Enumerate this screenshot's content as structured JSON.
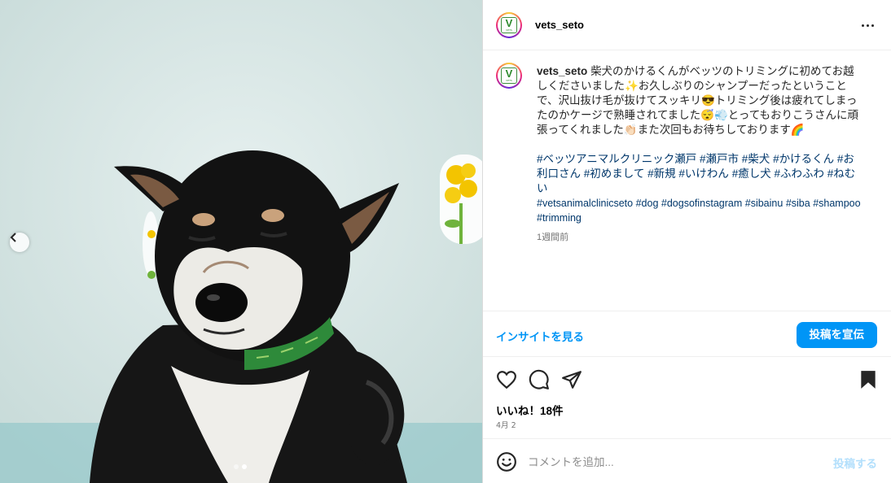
{
  "post": {
    "username": "vets_seto",
    "caption_text": "柴犬のかけるくんがベッツのトリミングに初めてお越しくださいました✨お久しぶりのシャンプーだったということで、沢山抜け毛が抜けてスッキリ😎トリミング後は疲れてしまったのかケージで熟睡されてました😴💨とってもおりこうさんに頑張ってくれました👏🏻また次回もお待ちしております🌈",
    "hashtags_ja": [
      "#ベッツアニマルクリニック瀬戸",
      "#瀬戸市",
      "#柴犬",
      "#かけるくん",
      "#お利口さん",
      "#初めまして",
      "#新規",
      "#いけわん",
      "#癒し犬",
      "#ふわふわ",
      "#ねむい"
    ],
    "hashtags_en": [
      "#vetsanimalclinicseto",
      "#dog",
      "#dogsofinstagram",
      "#sibainu",
      "#siba",
      "#shampoo",
      "#trimming"
    ],
    "time_ago": "1週間前",
    "likes": "いいね！18件",
    "date": "4月 2"
  },
  "actions": {
    "insights_label": "インサイトを見る",
    "promote_label": "投稿を宣伝"
  },
  "comment": {
    "placeholder": "コメントを追加...",
    "post_label": "投稿する"
  },
  "carousel": {
    "slide_count": 2,
    "active_slide": 2
  },
  "logo_text": {
    "letter": "V",
    "sub": "VETS"
  },
  "icons": [
    "more-icon",
    "heart-icon",
    "comment-icon",
    "share-icon",
    "bookmark-icon",
    "emoji-icon",
    "chevron-left-icon"
  ],
  "colors": {
    "accent": "#0095f6",
    "link": "#00376b",
    "muted": "#737373"
  }
}
